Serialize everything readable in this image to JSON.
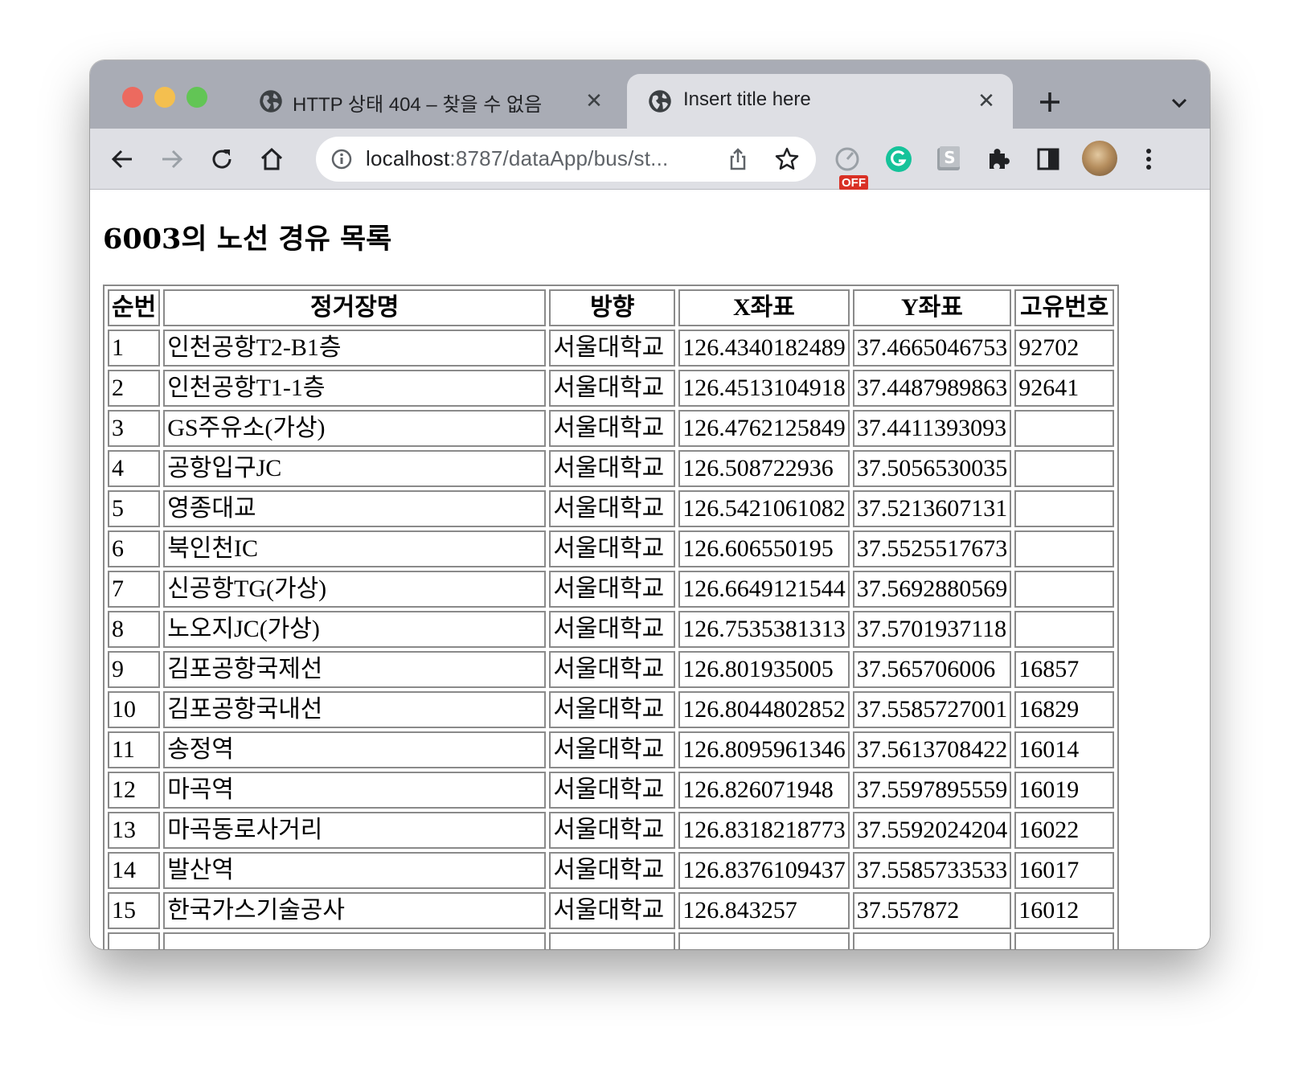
{
  "browser": {
    "tabs": [
      {
        "title": "HTTP 상태 404 – 찾을 수 없음",
        "active": false
      },
      {
        "title": "Insert title here",
        "active": true
      }
    ],
    "url_host": "localhost",
    "url_rest": ":8787/dataApp/bus/st...",
    "extension_badge": "OFF",
    "icons": [
      "back-arrow-icon",
      "forward-arrow-icon",
      "reload-icon",
      "home-icon",
      "info-icon",
      "share-icon",
      "star-icon",
      "speed-dial-icon",
      "grammarly-icon",
      "s-extension-icon",
      "puzzle-icon",
      "sidebar-icon",
      "avatar",
      "kebab-menu-icon"
    ]
  },
  "page": {
    "heading": "6003의 노선 경유 목록",
    "columns": [
      "순번",
      "정거장명",
      "방향",
      "X좌표",
      "Y좌표",
      "고유번호"
    ],
    "rows": [
      [
        "1",
        "인천공항T2-B1층",
        "서울대학교",
        "126.4340182489",
        "37.4665046753",
        "92702"
      ],
      [
        "2",
        "인천공항T1-1층",
        "서울대학교",
        "126.4513104918",
        "37.4487989863",
        "92641"
      ],
      [
        "3",
        "GS주유소(가상)",
        "서울대학교",
        "126.4762125849",
        "37.4411393093",
        ""
      ],
      [
        "4",
        "공항입구JC",
        "서울대학교",
        "126.508722936",
        "37.5056530035",
        ""
      ],
      [
        "5",
        "영종대교",
        "서울대학교",
        "126.5421061082",
        "37.5213607131",
        ""
      ],
      [
        "6",
        "북인천IC",
        "서울대학교",
        "126.606550195",
        "37.5525517673",
        ""
      ],
      [
        "7",
        "신공항TG(가상)",
        "서울대학교",
        "126.6649121544",
        "37.5692880569",
        ""
      ],
      [
        "8",
        "노오지JC(가상)",
        "서울대학교",
        "126.7535381313",
        "37.5701937118",
        ""
      ],
      [
        "9",
        "김포공항국제선",
        "서울대학교",
        "126.801935005",
        "37.565706006",
        "16857"
      ],
      [
        "10",
        "김포공항국내선",
        "서울대학교",
        "126.8044802852",
        "37.5585727001",
        "16829"
      ],
      [
        "11",
        "송정역",
        "서울대학교",
        "126.8095961346",
        "37.5613708422",
        "16014"
      ],
      [
        "12",
        "마곡역",
        "서울대학교",
        "126.826071948",
        "37.5597895559",
        "16019"
      ],
      [
        "13",
        "마곡동로사거리",
        "서울대학교",
        "126.8318218773",
        "37.5592024204",
        "16022"
      ],
      [
        "14",
        "발산역",
        "서울대학교",
        "126.8376109437",
        "37.5585733533",
        "16017"
      ],
      [
        "15",
        "한국가스기술공사",
        "서울대학교",
        "126.843257",
        "37.557872",
        "16012"
      ],
      [
        "",
        "",
        "",
        "",
        "",
        ""
      ]
    ]
  }
}
